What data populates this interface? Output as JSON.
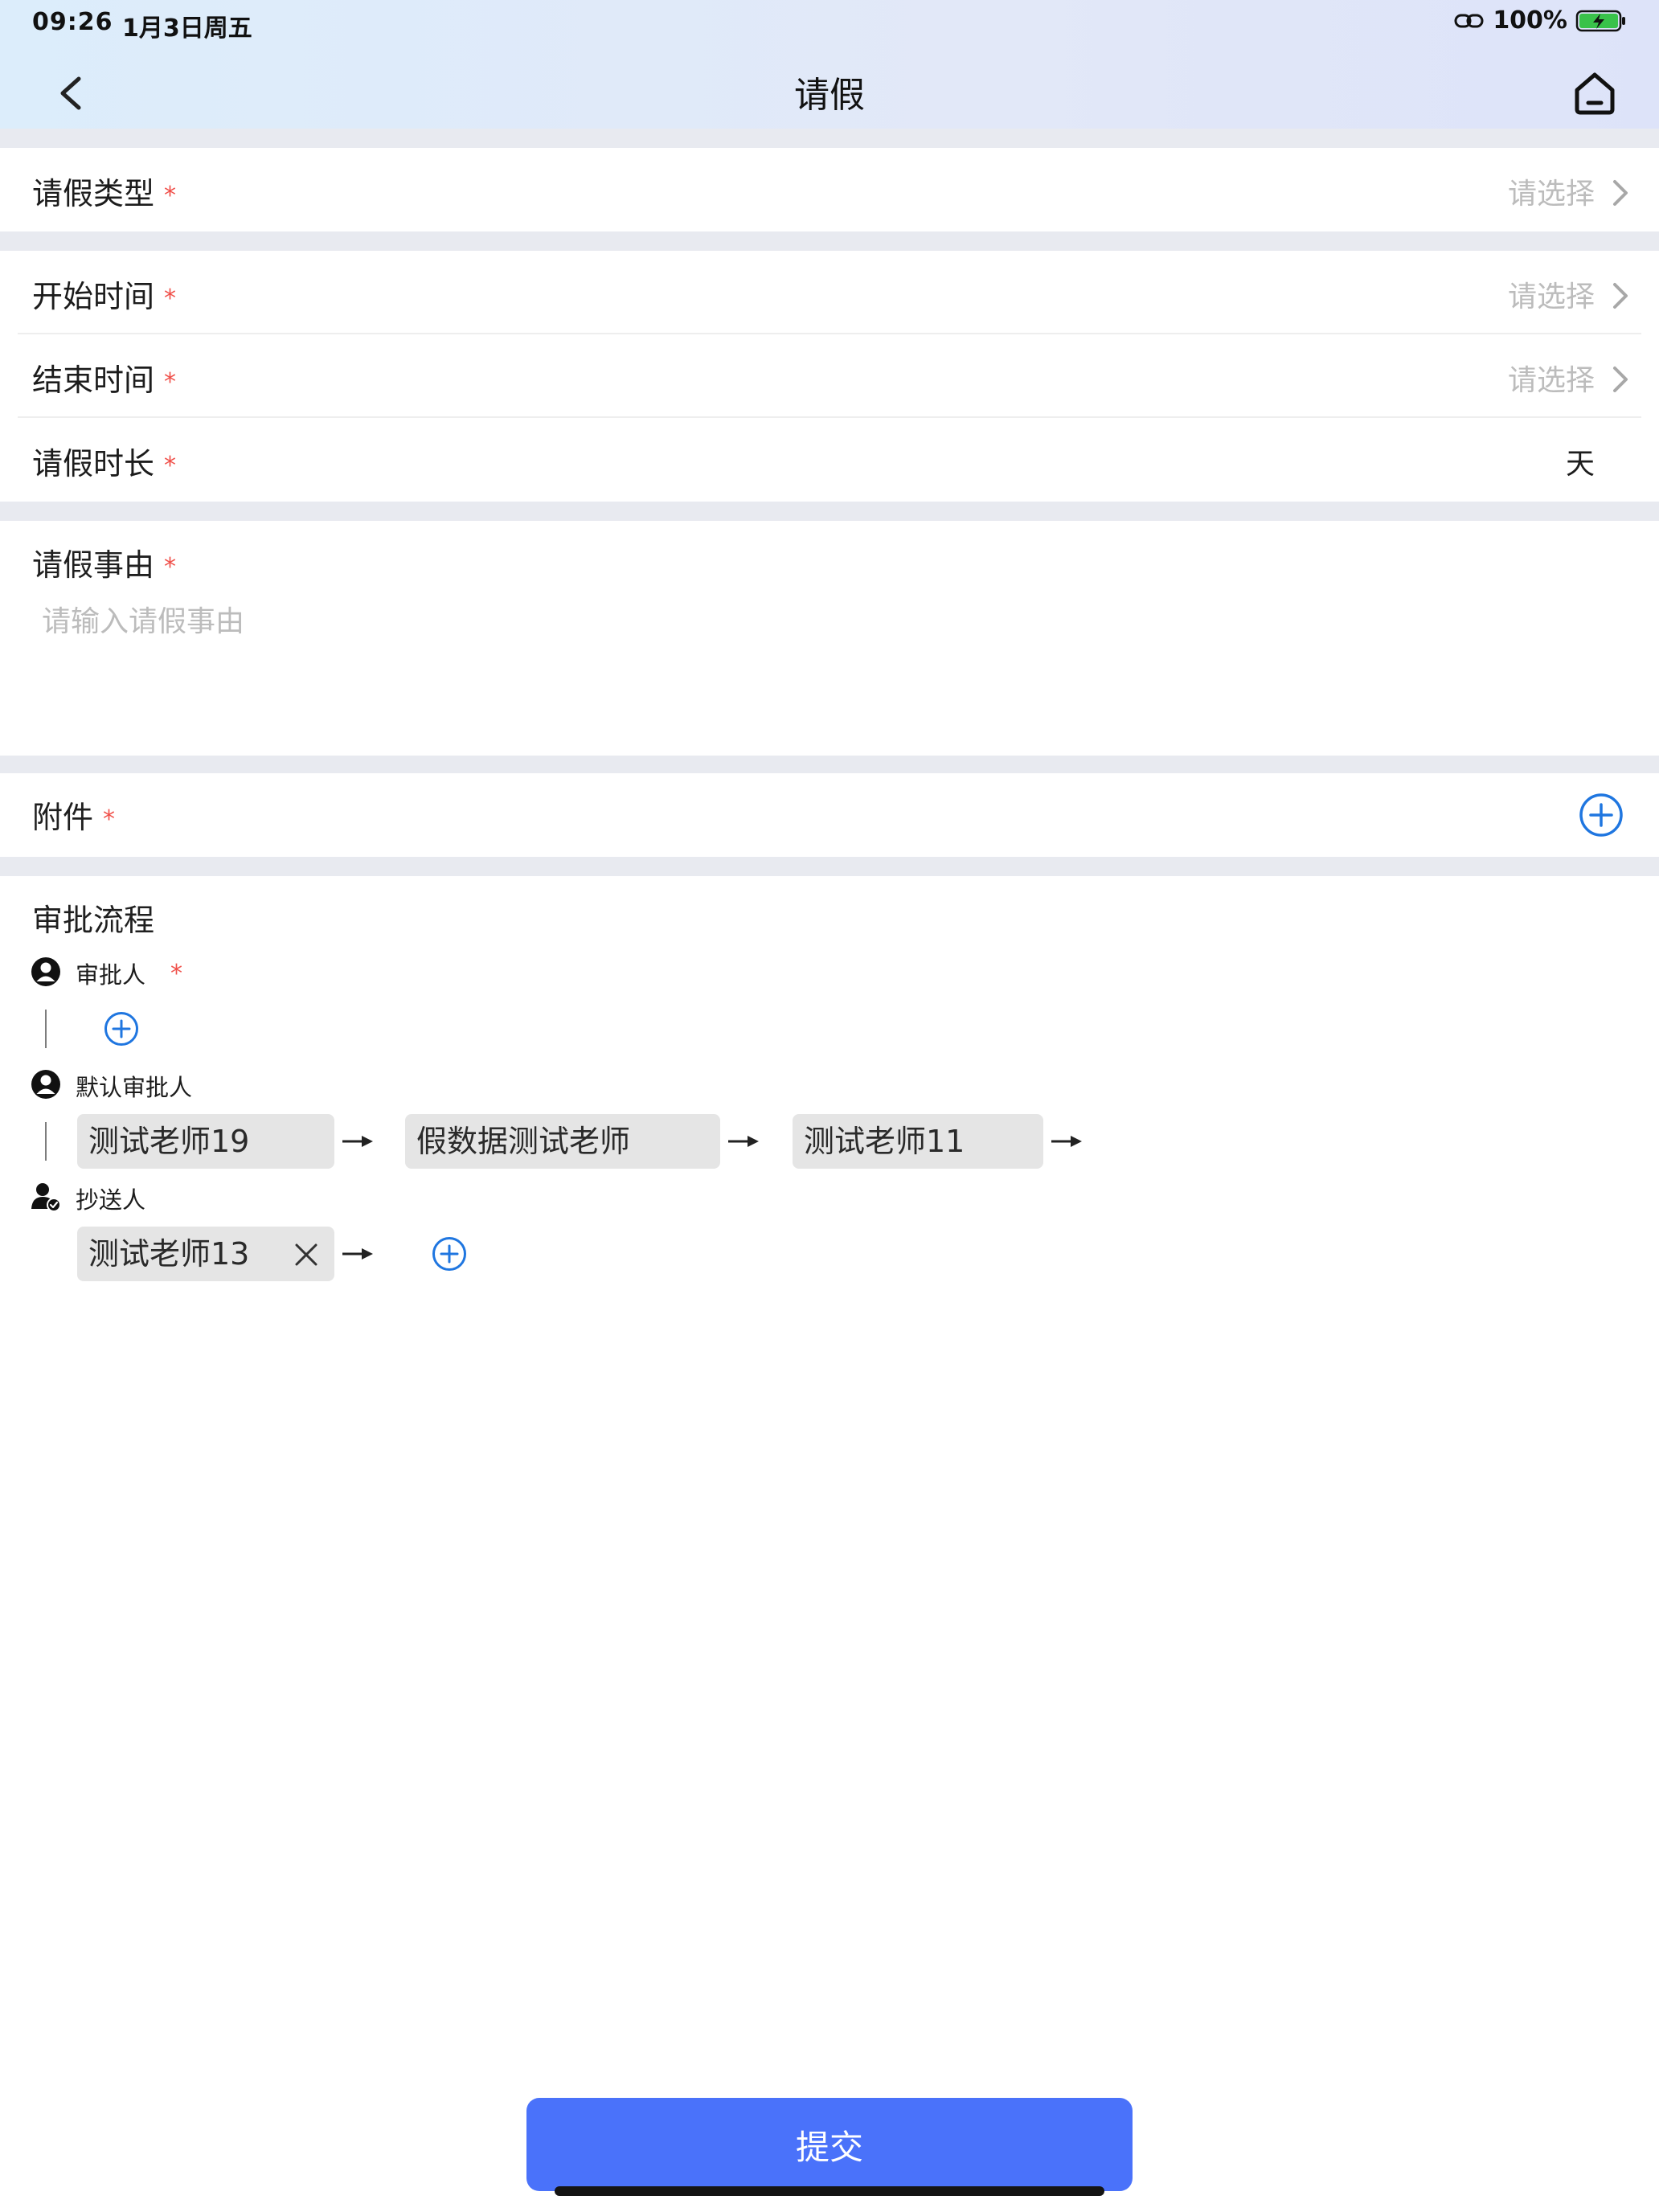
{
  "status_bar": {
    "time": "09:26",
    "date": "1月3日周五",
    "battery": "100%"
  },
  "nav": {
    "title": "请假"
  },
  "form": {
    "leave_type": {
      "label": "请假类型",
      "value": "请选择"
    },
    "start_time": {
      "label": "开始时间",
      "value": "请选择"
    },
    "end_time": {
      "label": "结束时间",
      "value": "请选择"
    },
    "duration": {
      "label": "请假时长",
      "unit": "天"
    },
    "reason": {
      "label": "请假事由",
      "placeholder": "请输入请假事由"
    },
    "attachment": {
      "label": "附件"
    },
    "required_mark": "*"
  },
  "approval": {
    "title": "审批流程",
    "approver_label": "审批人",
    "default_label": "默认审批人",
    "default_approvers": [
      "测试老师19",
      "假数据测试老师",
      "测试老师11"
    ],
    "cc_label": "抄送人",
    "cc_list": [
      "测试老师13"
    ]
  },
  "submit_label": "提交",
  "colors": {
    "accent": "#4a72fa",
    "required": "#f0514b",
    "plus": "#1f76e0"
  }
}
